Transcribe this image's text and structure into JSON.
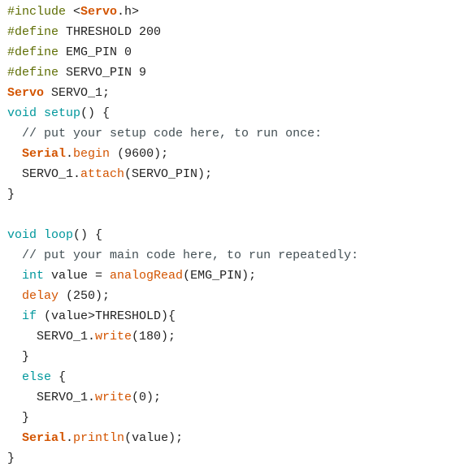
{
  "editor": {
    "language": "arduino",
    "colors": {
      "background": "#ffffff",
      "plain": "#222222",
      "preprocessor": "#5e6d03",
      "type_bold": "#d35400",
      "keyword": "#00979c",
      "function": "#d35400",
      "comment": "#434f54",
      "literal": "#005c5f"
    },
    "lines": [
      {
        "indent": "",
        "tokens": [
          {
            "t": "#include ",
            "c": "pre"
          },
          {
            "t": "<",
            "c": "plain"
          },
          {
            "t": "Servo",
            "c": "type"
          },
          {
            "t": ".h>",
            "c": "plain"
          }
        ]
      },
      {
        "indent": "",
        "tokens": [
          {
            "t": "#define",
            "c": "pre"
          },
          {
            "t": " THRESHOLD 200",
            "c": "plain"
          }
        ]
      },
      {
        "indent": "",
        "tokens": [
          {
            "t": "#define",
            "c": "pre"
          },
          {
            "t": " EMG_PIN 0",
            "c": "plain"
          }
        ]
      },
      {
        "indent": "",
        "tokens": [
          {
            "t": "#define",
            "c": "pre"
          },
          {
            "t": " SERVO_PIN 9",
            "c": "plain"
          }
        ]
      },
      {
        "indent": "",
        "tokens": [
          {
            "t": "Servo",
            "c": "type"
          },
          {
            "t": " SERVO_1;",
            "c": "plain"
          }
        ]
      },
      {
        "indent": "",
        "tokens": [
          {
            "t": "void",
            "c": "kw"
          },
          {
            "t": " ",
            "c": "plain"
          },
          {
            "t": "setup",
            "c": "kw"
          },
          {
            "t": "() {",
            "c": "plain"
          }
        ]
      },
      {
        "indent": "  ",
        "tokens": [
          {
            "t": "// put your setup code here, to run once:",
            "c": "cmt"
          }
        ]
      },
      {
        "indent": "  ",
        "tokens": [
          {
            "t": "Serial",
            "c": "type"
          },
          {
            "t": ".",
            "c": "plain"
          },
          {
            "t": "begin",
            "c": "fn"
          },
          {
            "t": " (9600);",
            "c": "plain"
          }
        ]
      },
      {
        "indent": "  ",
        "tokens": [
          {
            "t": "SERVO_1.",
            "c": "plain"
          },
          {
            "t": "attach",
            "c": "fn"
          },
          {
            "t": "(SERVO_PIN);",
            "c": "plain"
          }
        ]
      },
      {
        "indent": "",
        "tokens": [
          {
            "t": "}",
            "c": "plain"
          }
        ]
      },
      {
        "indent": "",
        "tokens": []
      },
      {
        "indent": "",
        "tokens": [
          {
            "t": "void",
            "c": "kw"
          },
          {
            "t": " ",
            "c": "plain"
          },
          {
            "t": "loop",
            "c": "kw"
          },
          {
            "t": "() {",
            "c": "plain"
          }
        ]
      },
      {
        "indent": "  ",
        "tokens": [
          {
            "t": "// put your main code here, to run repeatedly:",
            "c": "cmt"
          }
        ]
      },
      {
        "indent": "  ",
        "tokens": [
          {
            "t": "int",
            "c": "kw"
          },
          {
            "t": " value = ",
            "c": "plain"
          },
          {
            "t": "analogRead",
            "c": "fn"
          },
          {
            "t": "(EMG_PIN);",
            "c": "plain"
          }
        ]
      },
      {
        "indent": "  ",
        "tokens": [
          {
            "t": "delay",
            "c": "fn"
          },
          {
            "t": " (250);",
            "c": "plain"
          }
        ]
      },
      {
        "indent": "  ",
        "tokens": [
          {
            "t": "if",
            "c": "kw"
          },
          {
            "t": " (value>THRESHOLD){",
            "c": "plain"
          }
        ]
      },
      {
        "indent": "    ",
        "tokens": [
          {
            "t": "SERVO_1.",
            "c": "plain"
          },
          {
            "t": "write",
            "c": "fn"
          },
          {
            "t": "(180);",
            "c": "plain"
          }
        ]
      },
      {
        "indent": "  ",
        "tokens": [
          {
            "t": "}",
            "c": "plain"
          }
        ]
      },
      {
        "indent": "  ",
        "tokens": [
          {
            "t": "else",
            "c": "kw"
          },
          {
            "t": " {",
            "c": "plain"
          }
        ]
      },
      {
        "indent": "    ",
        "tokens": [
          {
            "t": "SERVO_1.",
            "c": "plain"
          },
          {
            "t": "write",
            "c": "fn"
          },
          {
            "t": "(0);",
            "c": "plain"
          }
        ]
      },
      {
        "indent": "  ",
        "tokens": [
          {
            "t": "}",
            "c": "plain"
          }
        ]
      },
      {
        "indent": "  ",
        "tokens": [
          {
            "t": "Serial",
            "c": "type"
          },
          {
            "t": ".",
            "c": "plain"
          },
          {
            "t": "println",
            "c": "fn"
          },
          {
            "t": "(value);",
            "c": "plain"
          }
        ]
      },
      {
        "indent": "",
        "tokens": [
          {
            "t": "}",
            "c": "plain"
          }
        ]
      }
    ]
  }
}
